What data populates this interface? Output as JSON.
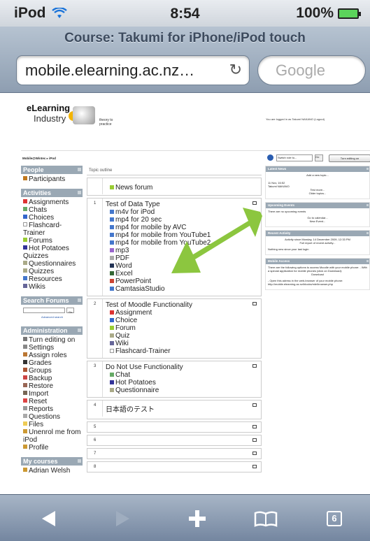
{
  "status_bar": {
    "device": "iPod",
    "time": "8:54",
    "battery": "100%"
  },
  "browser": {
    "page_title": "Course: Takumi for iPhone/iPod touch",
    "url": "mobile.elearning.ac.nz…",
    "search_placeholder": "Google"
  },
  "site": {
    "logo_main": "eLearning",
    "logo_sub": "Industry",
    "logo_tagline": "theory to practice",
    "logged_in_text": "You are logged in as Takumi NAKANO (Logout)",
    "breadcrumb": "Mobile@Wintec ▸ iPod",
    "role_select": "Switch role to...",
    "role_go": "Go",
    "edit_button": "Turn editing on"
  },
  "left_blocks": {
    "people_title": "People",
    "people_items": [
      "Participants"
    ],
    "activities_title": "Activities",
    "activities_items": [
      "Assignments",
      "Chats",
      "Choices",
      "Flashcard-Trainer",
      "Forums",
      "Hot Potatoes Quizzes",
      "Questionnaires",
      "Quizzes",
      "Resources",
      "Wikis"
    ],
    "search_title": "Search Forums",
    "search_go": "Go",
    "search_advanced": "Advanced search",
    "admin_title": "Administration",
    "admin_items": [
      "Turn editing on",
      "Settings",
      "Assign roles",
      "Grades",
      "Groups",
      "Backup",
      "Restore",
      "Import",
      "Reset",
      "Reports",
      "Questions",
      "Files",
      "Unenrol me from iPod",
      "Profile"
    ],
    "mycourses_title": "My courses",
    "mycourses_item": "Adrian Welsh"
  },
  "outline": {
    "header": "Topic outline",
    "sec0_items": [
      "News forum"
    ],
    "sec1_num": "1",
    "sec1_title": "Test of Data Type",
    "sec1_items": [
      "m4v for iPod",
      "mp4 for 20 sec",
      "mp4 for mobile by AVC",
      "mp4 for mobile from YouTube1",
      "mp4 for mobile from YouTube2",
      "mp3",
      "PDF",
      "Word",
      "Excel",
      "PowerPoint",
      "CamtasiaStudio"
    ],
    "sec2_num": "2",
    "sec2_title": "Test of Moodle Functionality",
    "sec2_items": [
      "Assignment",
      "Choice",
      "Forum",
      "Quiz",
      "Wiki",
      "Flashcard-Trainer"
    ],
    "sec3_num": "3",
    "sec3_title": "Do Not Use Functionality",
    "sec3_items": [
      "Chat",
      "Hot Potatoes",
      "Questionnaire"
    ],
    "sec4_num": "4",
    "sec4_title": "日本語のテスト",
    "sec5_num": "5",
    "sec6_num": "6",
    "sec7_num": "7",
    "sec8_num": "8"
  },
  "right_blocks": {
    "news_title": "Latest News",
    "news_add": "Add a new topic...",
    "news_date": "11 Nov, 16:52",
    "news_author": "Takumi NAKANO",
    "news_more": "Test more...",
    "news_older": "Older topics...",
    "events_title": "Upcoming Events",
    "events_none": "There are no upcoming events",
    "events_calendar": "Go to calendar...",
    "events_new": "New Event...",
    "activity_title": "Recent Activity",
    "activity_since": "Activity since Monday, 14 December 2009, 12:33 PM",
    "activity_full": "Full report of recent activity...",
    "activity_none": "Nothing new since your last login",
    "access_title": "Mobile Access",
    "access_text": "There are the following options to access Moodle with your mobile phone: - With a special application for mobile phones (click on Download):",
    "access_download": "Download",
    "access_text2": "- Open this adress in the web-browser of your mobile phone:",
    "access_url": "http://mobile.elearning.ac.nz/blocks/mle/browser.php"
  },
  "toolbar": {
    "tab_count": "6"
  },
  "colors": {
    "arrow": "#8cc63f",
    "block_header": "#9aa8b4",
    "chrome": "#8e9eb1"
  }
}
